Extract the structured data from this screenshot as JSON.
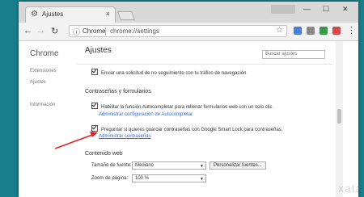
{
  "window": {
    "user_chip": "",
    "min": "—",
    "max": "☐",
    "close": "✕"
  },
  "tab": {
    "title": "Ajustes",
    "close": "×"
  },
  "toolbar": {
    "back": "←",
    "forward": "→",
    "reload": "↻",
    "menu": "⋮"
  },
  "omnibox": {
    "chip": "Chrome",
    "url": "chrome://settings",
    "star": "☆"
  },
  "sidebar": {
    "brand": "Chrome",
    "items": [
      "Extensiones",
      "Ajustes",
      "Información"
    ]
  },
  "main": {
    "title": "Ajustes",
    "search_placeholder": "Buscar ajustes",
    "rows": [
      "Enviar una solicitud de no seguimiento con tu tráfico de navegación"
    ],
    "section_passwords": "Contraseñas y formularios",
    "autofill_checkbox": "Habilitar la función Autocompletar para rellenar formularios web con un solo clic",
    "autofill_link": "Administrar configuración de Autocompletar",
    "passwords_checkbox": "Preguntar si quieres guardar contraseñas con Google Smart Lock para contraseñas.",
    "passwords_link": "Administrar contraseñas",
    "section_web": "Contenido web",
    "font_size_label": "Tamaño de fuente:",
    "font_size_value": "Mediano",
    "customize_fonts": "Personalizar fuentes...",
    "zoom_label": "Zoom de página:",
    "zoom_value": "100 %"
  },
  "watermark": "xataka",
  "colors": {
    "accent_link": "#3367d6",
    "annotation_arrow": "#e02020",
    "background": "#1a7f8c"
  }
}
